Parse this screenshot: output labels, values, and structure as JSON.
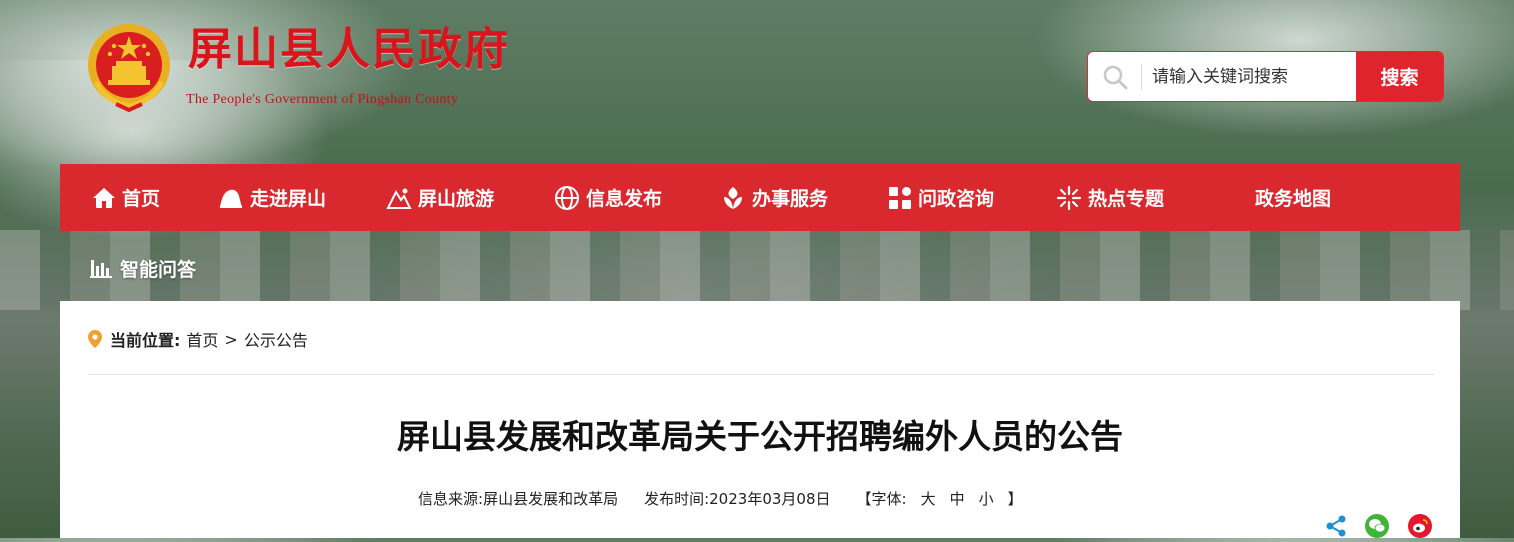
{
  "header": {
    "title": "屏山县人民政府",
    "subtitle": "The People's Government of Pingshan County"
  },
  "search": {
    "placeholder": "请输入关键词搜索",
    "button_label": "搜索"
  },
  "nav": {
    "items": [
      {
        "label": "首页",
        "icon": "home-icon"
      },
      {
        "label": "走进屏山",
        "icon": "mountain-hill-icon"
      },
      {
        "label": "屏山旅游",
        "icon": "tourism-icon"
      },
      {
        "label": "信息发布",
        "icon": "globe-icon"
      },
      {
        "label": "办事服务",
        "icon": "service-icon"
      },
      {
        "label": "问政咨询",
        "icon": "grid-icon"
      },
      {
        "label": "热点专题",
        "icon": "star-burst-icon"
      },
      {
        "label": "政务地图",
        "icon": ""
      },
      {
        "label": "智能问答",
        "icon": "bar-chart-icon"
      }
    ]
  },
  "breadcrumb": {
    "label": "当前位置:",
    "items": [
      "首页",
      "公示公告"
    ],
    "separator": ">"
  },
  "article": {
    "title": "屏山县发展和改革局关于公开招聘编外人员的公告",
    "source_label": "信息来源:",
    "source": "屏山县发展和改革局",
    "date_label": "发布时间:",
    "date": "2023年03月08日",
    "font_label": "【字体:",
    "font_sizes": [
      "大",
      "中",
      "小"
    ],
    "font_close": "】"
  },
  "share": {
    "icons": [
      "share-icon",
      "wechat-icon",
      "weibo-icon"
    ]
  },
  "colors": {
    "brand_red": "#d9282e",
    "title_red": "#d9141b"
  }
}
